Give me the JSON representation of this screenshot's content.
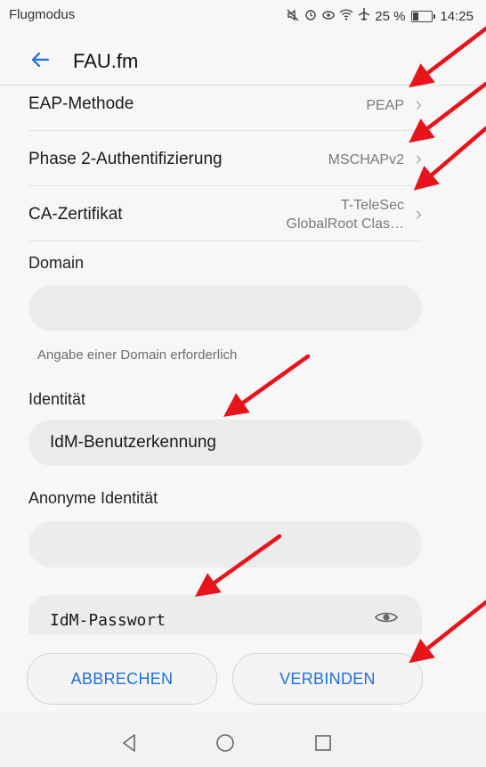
{
  "status_bar": {
    "left_text": "Flugmodus",
    "icons": [
      "mute-icon",
      "alarm-icon",
      "eye-comfort-icon",
      "wifi-icon",
      "airplane-icon"
    ],
    "battery_text": "25 %",
    "time": "14:25"
  },
  "app_bar": {
    "back_icon": "back-arrow-icon",
    "title": "FAU.fm",
    "accent_color": "#1e6fdc"
  },
  "settings": {
    "eap_method": {
      "label": "EAP-Methode",
      "value": "PEAP"
    },
    "phase2": {
      "label": "Phase 2-Authentifizierung",
      "value": "MSCHAPv2"
    },
    "ca_cert": {
      "label": "CA-Zertifikat",
      "value_line1": "T-TeleSec",
      "value_line2": "GlobalRoot Clas…"
    }
  },
  "domain": {
    "label": "Domain",
    "value": "",
    "hint": "Angabe einer Domain erforderlich"
  },
  "identity": {
    "label": "Identität",
    "value": "IdM-Benutzerkennung"
  },
  "anonymous_identity": {
    "label": "Anonyme Identität",
    "value": ""
  },
  "password": {
    "value": "IdM-Passwort",
    "toggle_icon": "eye-icon"
  },
  "buttons": {
    "cancel": "ABBRECHEN",
    "connect": "VERBINDEN"
  },
  "nav_bar": {
    "back": "nav-back-icon",
    "home": "nav-home-icon",
    "recents": "nav-recents-icon"
  },
  "annotation_color": "#e8141b"
}
